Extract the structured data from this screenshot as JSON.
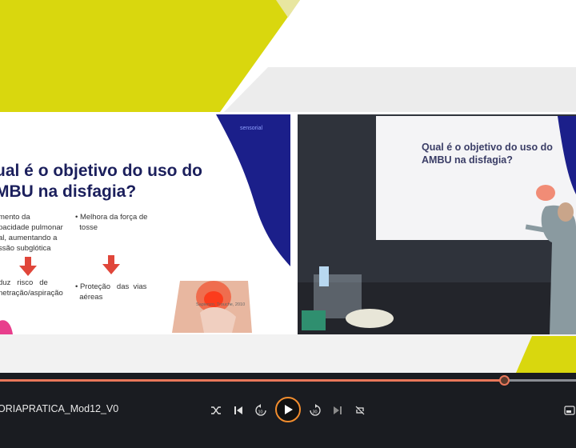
{
  "slide": {
    "title": "ual é o objetivo do uso do\nMBU na disfagia?",
    "logo_text": "sensorial",
    "bullets": [
      {
        "text": "mento da\npacidade pulmonar\nal, aumentando a\nssão subglótica"
      },
      {
        "text": "• Melhora da força de\n  tosse"
      },
      {
        "text": "duz   risco   de\nnetração/aspiração"
      },
      {
        "text": "• Proteção   das  vias\n  aéreas"
      }
    ],
    "citation": "Sapienzo, Trouche, 2010"
  },
  "camera": {
    "slide_title": "Qual é o objetivo do uso do\nAMBU na disfagia?"
  },
  "player": {
    "filename": "ORIAPRATICA_Mod12_V0",
    "progress": 0.875,
    "colors": {
      "accent": "#e9775a",
      "play_ring": "#f28d2e",
      "bar_bg": "#1a1c21"
    }
  },
  "icons": [
    "shuffle-icon",
    "previous-icon",
    "rewind-10-icon",
    "play-icon",
    "forward-30-icon",
    "next-icon",
    "repeat-icon",
    "miniplayer-icon"
  ]
}
